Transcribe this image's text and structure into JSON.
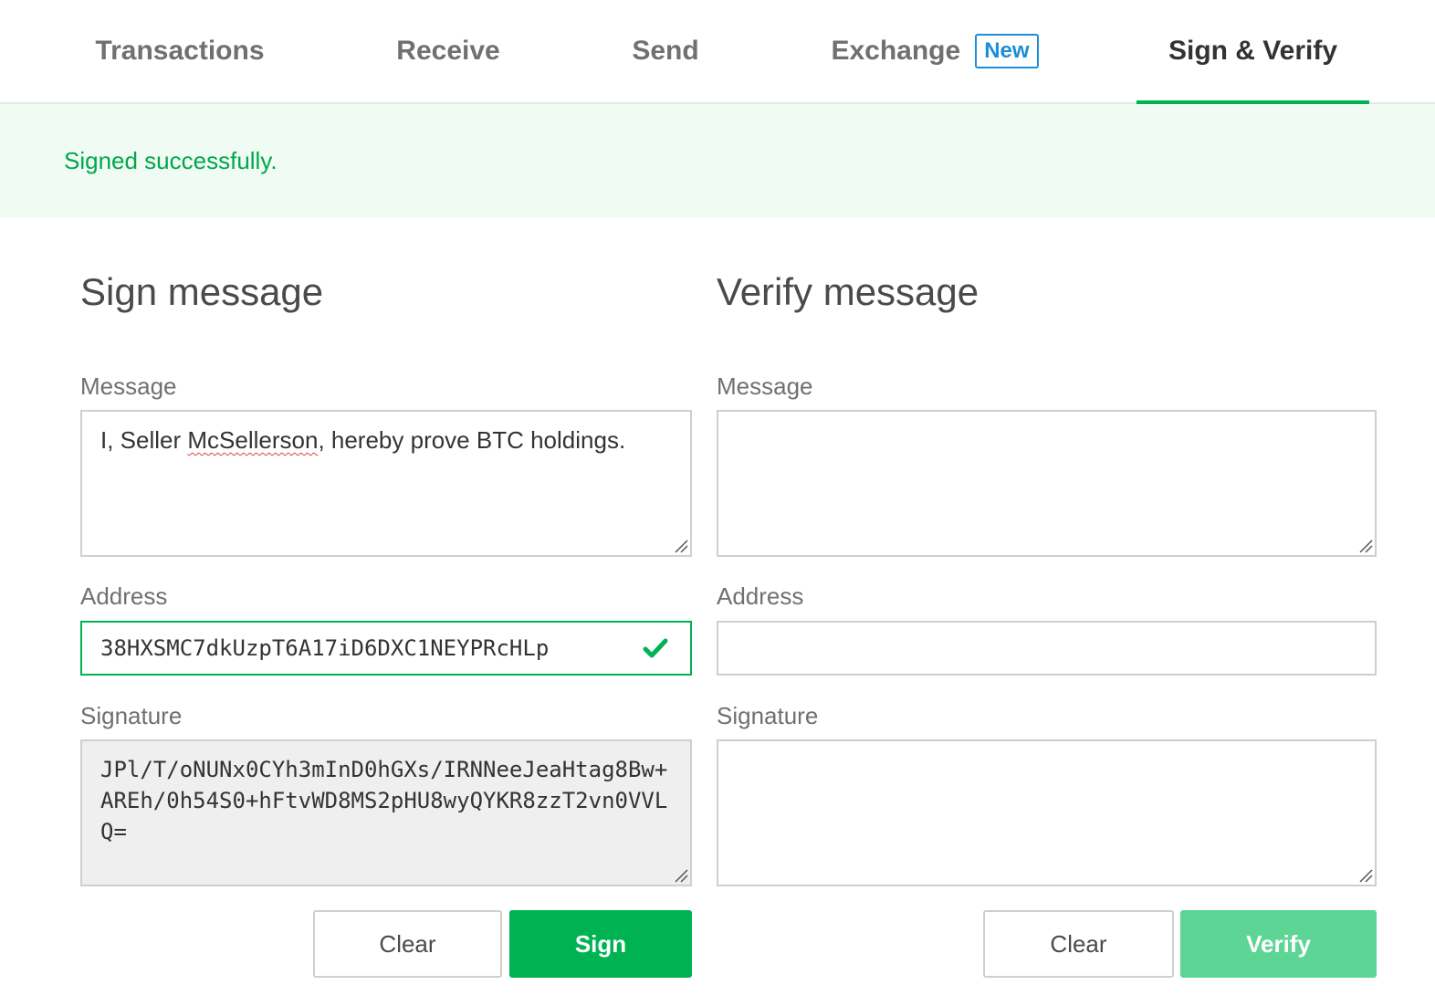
{
  "tabs": [
    {
      "label": "Transactions",
      "active": false
    },
    {
      "label": "Receive",
      "active": false
    },
    {
      "label": "Send",
      "active": false
    },
    {
      "label": "Exchange",
      "active": false,
      "badge": "New"
    },
    {
      "label": "Sign & Verify",
      "active": true
    }
  ],
  "banner": {
    "message": "Signed successfully."
  },
  "sign": {
    "title": "Sign message",
    "message_label": "Message",
    "message_value_pre": "I, Seller ",
    "message_value_misspelled": "McSellerson",
    "message_value_post": ", hereby prove BTC holdings.",
    "address_label": "Address",
    "address_value": "38HXSMC7dkUzpT6A17iD6DXC1NEYPRcHLp",
    "address_valid": true,
    "signature_label": "Signature",
    "signature_value": "JPl/T/oNUNx0CYh3mInD0hGXs/IRNNeeJeaHtag8Bw+AREh/0h54S0+hFtvWD8MS2pHU8wyQYKR8zzT2vn0VVLQ=",
    "clear_label": "Clear",
    "submit_label": "Sign"
  },
  "verify": {
    "title": "Verify message",
    "message_label": "Message",
    "message_value": "",
    "address_label": "Address",
    "address_value": "",
    "signature_label": "Signature",
    "signature_value": "",
    "clear_label": "Clear",
    "submit_label": "Verify",
    "submit_enabled": false
  },
  "colors": {
    "accent_green": "#00b352",
    "success_text": "#00a84a",
    "banner_bg": "#f0fbf4",
    "badge_blue": "#1c8ed6"
  },
  "icons": {
    "address_valid": "checkmark-icon",
    "resize": "resize-grip-icon"
  }
}
